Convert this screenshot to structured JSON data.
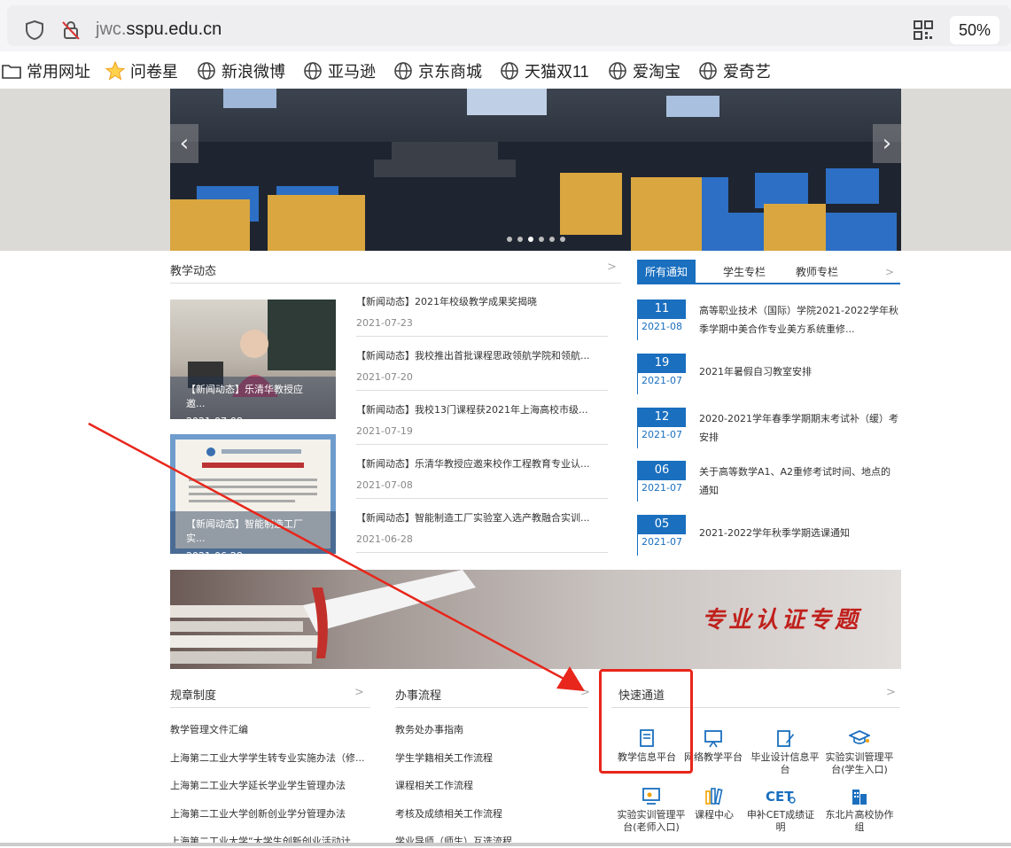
{
  "browser": {
    "url_prefix": "jwc.",
    "url_domain": "sspu.edu.cn",
    "zoom": "50%",
    "bookmarks": [
      "常用网址",
      "问卷星",
      "新浪微博",
      "亚马逊",
      "京东商城",
      "天猫双11",
      "爱淘宝",
      "爱奇艺"
    ]
  },
  "teaching_news": {
    "title": "教学动态",
    "more": ">",
    "photos": [
      {
        "caption": "【新闻动态】乐清华教授应邀...",
        "date": "2021-07-08"
      },
      {
        "caption": "【新闻动态】智能制造工厂实...",
        "date": "2021-06-28"
      }
    ],
    "items": [
      {
        "title": "【新闻动态】2021年校级教学成果奖揭晓",
        "date": "2021-07-23"
      },
      {
        "title": "【新闻动态】我校推出首批课程思政领航学院和领航...",
        "date": "2021-07-20"
      },
      {
        "title": "【新闻动态】我校13门课程获2021年上海高校市级...",
        "date": "2021-07-19"
      },
      {
        "title": "【新闻动态】乐清华教授应邀来校作工程教育专业认...",
        "date": "2021-07-08"
      },
      {
        "title": "【新闻动态】智能制造工厂实验室入选产教融合实训...",
        "date": "2021-06-28"
      }
    ]
  },
  "notices": {
    "tabs": [
      "所有通知",
      "学生专栏",
      "教师专栏"
    ],
    "more": ">",
    "items": [
      {
        "day": "11",
        "ym": "2021-08",
        "text": "高等职业技术（国际）学院2021-2022学年秋季学期中美合作专业美方系统重修..."
      },
      {
        "day": "19",
        "ym": "2021-07",
        "text": "2021年暑假自习教室安排"
      },
      {
        "day": "12",
        "ym": "2021-07",
        "text": "2020-2021学年春季学期期末考试补（缓）考安排"
      },
      {
        "day": "06",
        "ym": "2021-07",
        "text": "关于高等数学A1、A2重修考试时间、地点的通知"
      },
      {
        "day": "05",
        "ym": "2021-07",
        "text": "2021-2022学年秋季学期选课通知"
      }
    ]
  },
  "cert_banner": {
    "text": "专业认证专题"
  },
  "regulations": {
    "title": "规章制度",
    "more": ">",
    "items": [
      "教学管理文件汇编",
      "上海第二工业大学学生转专业实施办法（修...",
      "上海第二工业大学延长学业学生管理办法",
      "上海第二工业大学创新创业学分管理办法",
      "上海第二工业大学“大学生创新创业活动计..."
    ]
  },
  "procedures": {
    "title": "办事流程",
    "more": ">",
    "items": [
      "教务处办事指南",
      "学生学籍相关工作流程",
      "课程相关工作流程",
      "考核及成绩相关工作流程",
      "学业导师（师生）互选流程"
    ]
  },
  "quick": {
    "title": "快速通道",
    "more": ">",
    "items": [
      {
        "label": "教学信息平台",
        "icon": "document-icon"
      },
      {
        "label": "网络教学平台",
        "icon": "presentation-icon"
      },
      {
        "label": "毕业设计信息平台",
        "icon": "edit-icon"
      },
      {
        "label": "实验实训管理平台(学生入口)",
        "icon": "graduation-cap-icon"
      },
      {
        "label": "实验实训管理平台(老师入口)",
        "icon": "monitor-icon"
      },
      {
        "label": "课程中心",
        "icon": "books-icon"
      },
      {
        "label": "申补CET成绩证明",
        "icon": "cet-icon"
      },
      {
        "label": "东北片高校协作组",
        "icon": "building-icon"
      }
    ]
  },
  "colors": {
    "accent": "#1a6fbf",
    "annotation": "#e8261b"
  }
}
